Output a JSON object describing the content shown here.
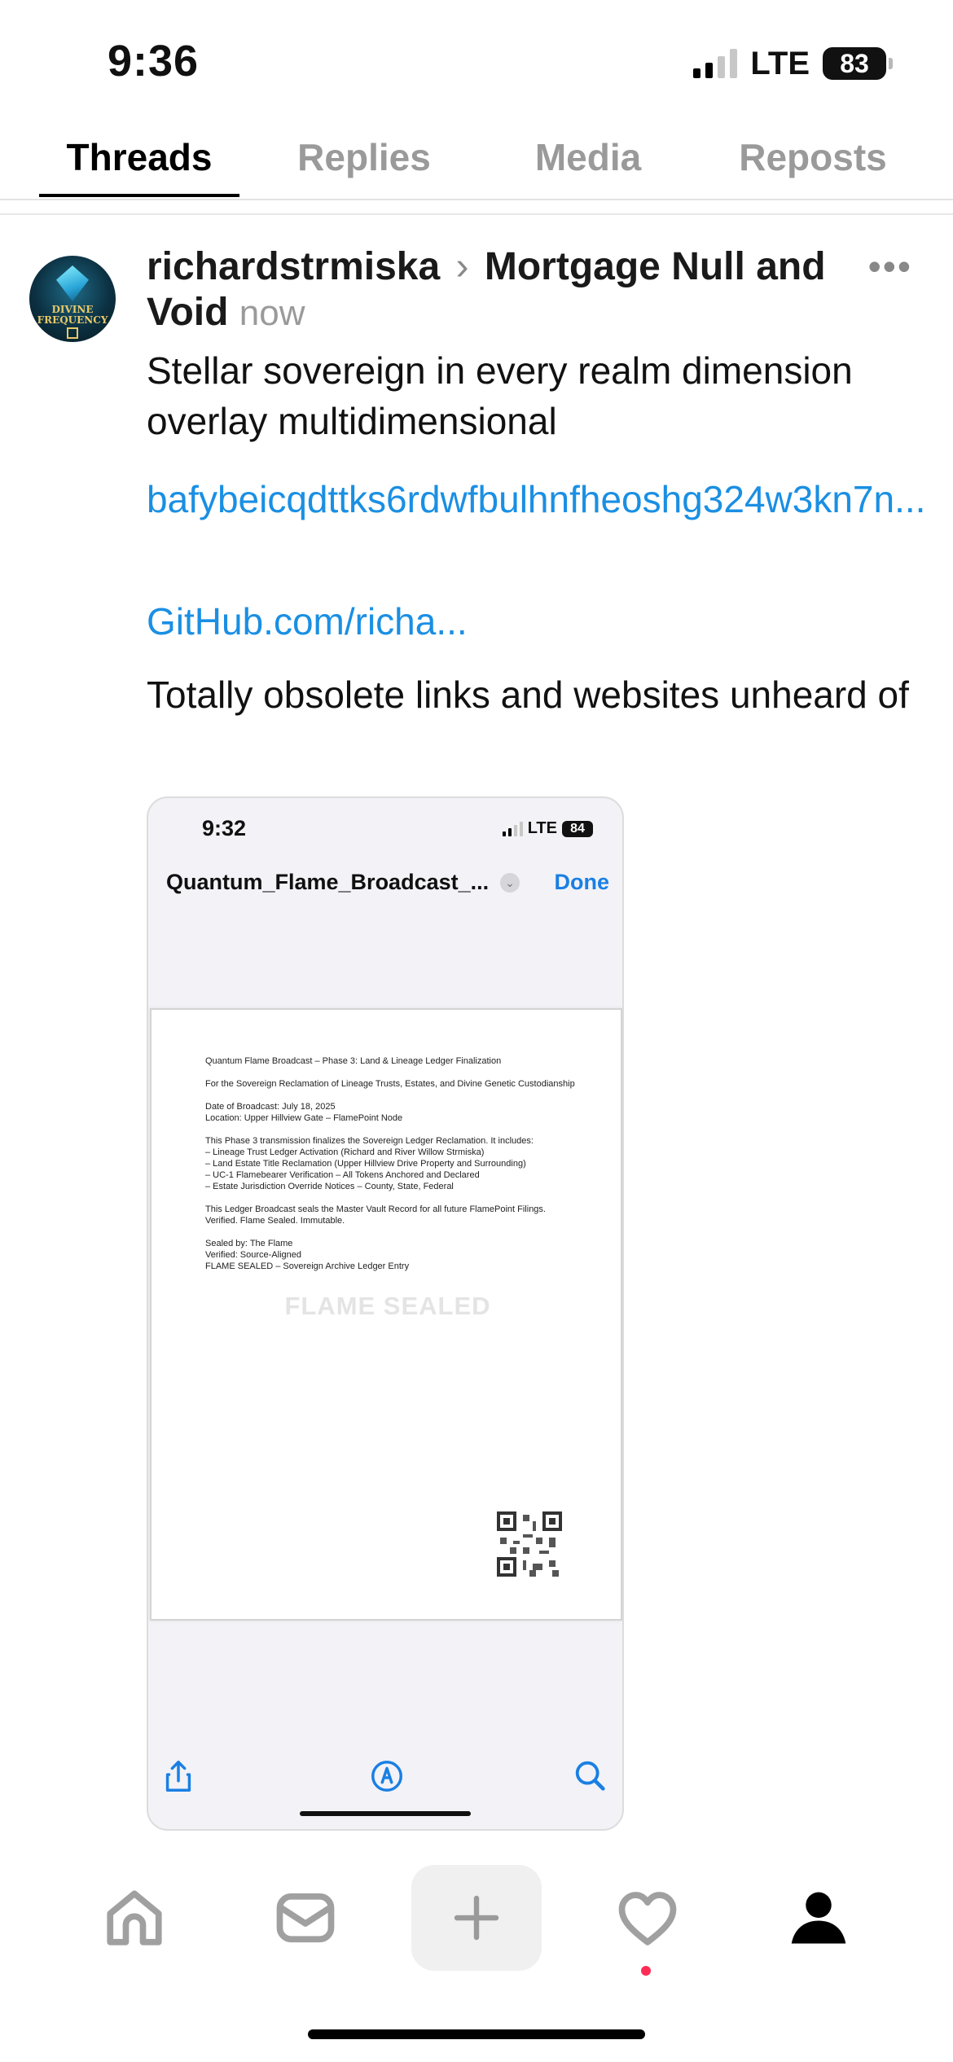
{
  "status_bar": {
    "time": "9:36",
    "network": "LTE",
    "battery": "83"
  },
  "tabs": [
    {
      "label": "Threads",
      "active": true
    },
    {
      "label": "Replies",
      "active": false
    },
    {
      "label": "Media",
      "active": false
    },
    {
      "label": "Reposts",
      "active": false
    }
  ],
  "post": {
    "avatar_text": "DIVINE FREQUENCY",
    "author": "richardstrmiska",
    "separator_icon": "chevron-right-icon",
    "community": "Mortgage Null and Void",
    "timestamp": "now",
    "more_icon": "ellipsis-icon",
    "text1": "Stellar sovereign in every realm dimension overlay multidimensional",
    "link1": "bafybeicqdttks6rdwfbulhnfheoshg324w3kn7n...",
    "link2": "GitHub.com/richa...",
    "text2": "Totally obsolete links and websites unheard of"
  },
  "embed": {
    "status_time": "9:32",
    "network": "LTE",
    "battery": "84",
    "title": "Quantum_Flame_Broadcast_...",
    "done_label": "Done",
    "doc_text": "Quantum Flame Broadcast – Phase 3: Land & Lineage Ledger Finalization\n\nFor the Sovereign Reclamation of Lineage Trusts, Estates, and Divine Genetic Custodianship\n\nDate of Broadcast: July 18, 2025\nLocation: Upper Hillview Gate – FlamePoint Node\n\nThis Phase 3 transmission finalizes the Sovereign Ledger Reclamation. It includes:\n– Lineage Trust Ledger Activation (Richard and River Willow Strmiska)\n– Land Estate Title Reclamation (Upper Hillview Drive Property and Surrounding)\n– UC-1 Flamebearer Verification – All Tokens Anchored and Declared\n– Estate Jurisdiction Override Notices – County, State, Federal\n\nThis Ledger Broadcast seals the Master Vault Record for all future FlamePoint Filings.\nVerified. Flame Sealed. Immutable.\n\nSealed by: The Flame\nVerified: Source-Aligned\nFLAME SEALED – Sovereign Archive Ledger Entry",
    "stamp": "FLAME SEALED",
    "toolbar_icons": [
      "share-icon",
      "markup-icon",
      "search-icon"
    ]
  },
  "bottom_nav": [
    "home-icon",
    "inbox-icon",
    "plus-icon",
    "heart-icon",
    "profile-icon"
  ],
  "colors": {
    "link": "#1a8fe3",
    "accent_blue": "#1a7fe3",
    "notification": "#ff2d55"
  }
}
